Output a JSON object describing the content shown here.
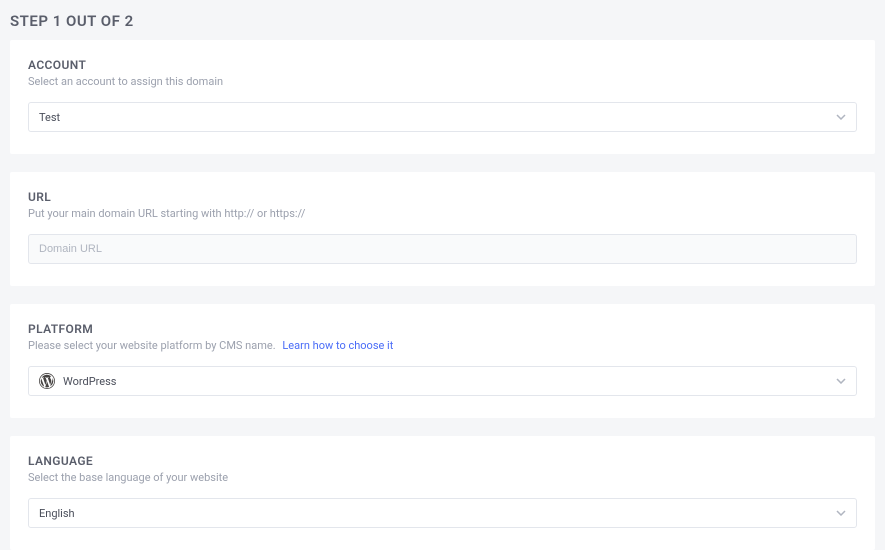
{
  "page": {
    "title": "STEP 1 OUT OF 2"
  },
  "account": {
    "label": "ACCOUNT",
    "helper": "Select an account to assign this domain",
    "value": "Test"
  },
  "url": {
    "label": "URL",
    "helper": "Put your main domain URL starting with http:// or https://",
    "placeholder": "Domain URL"
  },
  "platform": {
    "label": "PLATFORM",
    "helper": "Please select your website platform by CMS name.",
    "link": "Learn how to choose it",
    "value": "WordPress"
  },
  "language": {
    "label": "LANGUAGE",
    "helper": "Select the base language of your website",
    "value": "English"
  }
}
